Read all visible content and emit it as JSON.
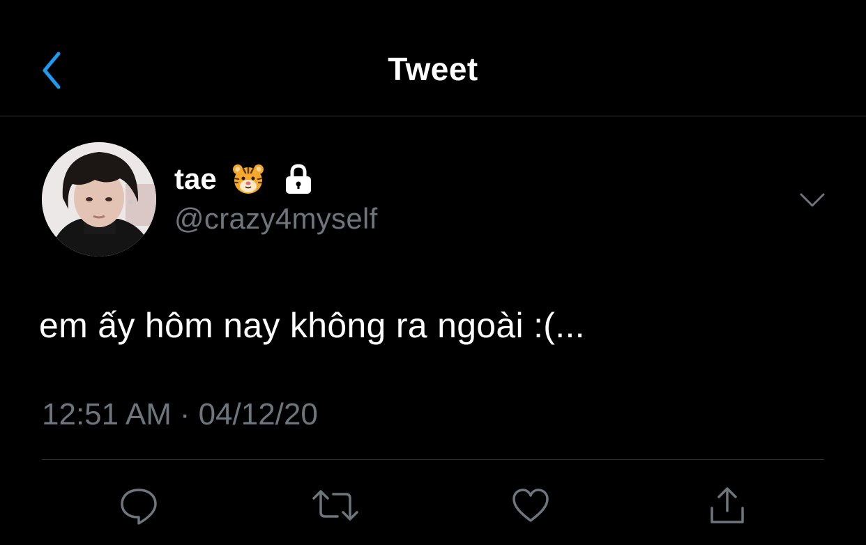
{
  "header": {
    "title": "Tweet",
    "back_icon": "chevron-left-icon"
  },
  "tweet": {
    "display_name": "tae",
    "name_emoji": "tiger-face-icon",
    "protected_icon": "lock-icon",
    "handle": "@crazy4myself",
    "text": "em ấy hôm nay không ra ngoài :(...",
    "time": "12:51 AM",
    "separator": "·",
    "date": "04/12/20"
  },
  "actions": [
    {
      "name": "reply",
      "icon": "comment-icon"
    },
    {
      "name": "retweet",
      "icon": "retweet-icon"
    },
    {
      "name": "like",
      "icon": "heart-icon"
    },
    {
      "name": "share",
      "icon": "share-icon"
    }
  ],
  "colors": {
    "background": "#000000",
    "accent": "#1d9bf0",
    "secondary_text": "#6e767d",
    "divider": "#2f3336"
  }
}
